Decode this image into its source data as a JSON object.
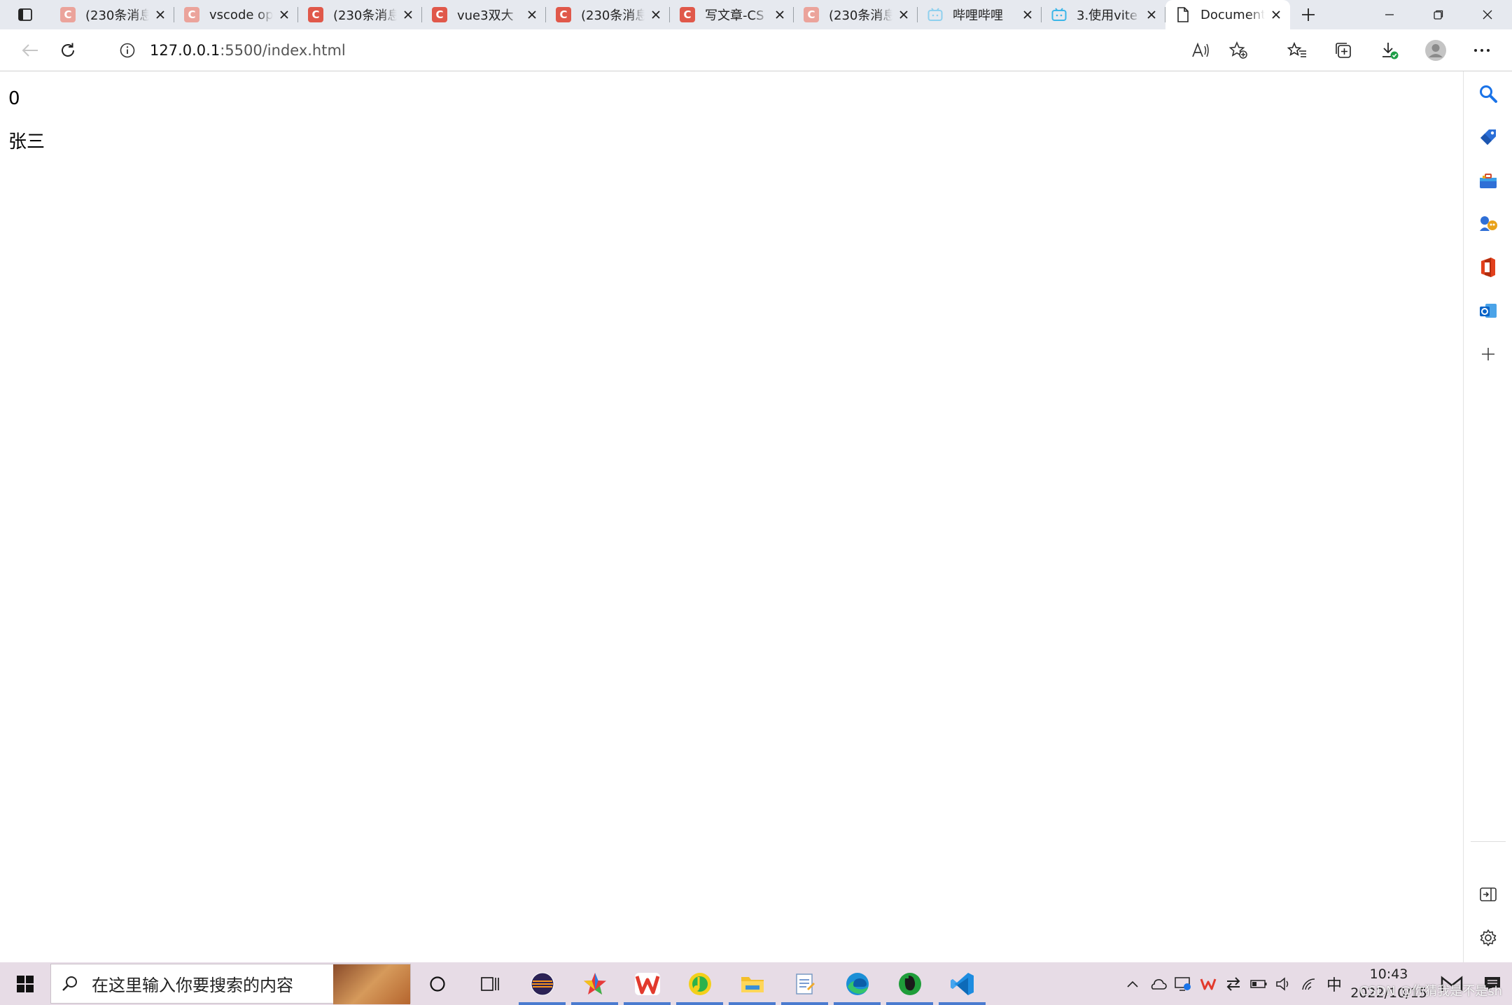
{
  "browser": {
    "tabs": [
      {
        "title": "(230条消息",
        "favicon": "csdn-dim"
      },
      {
        "title": "vscode op",
        "favicon": "csdn-dim"
      },
      {
        "title": "(230条消息",
        "favicon": "csdn"
      },
      {
        "title": "vue3双大",
        "favicon": "csdn"
      },
      {
        "title": "(230条消息",
        "favicon": "csdn"
      },
      {
        "title": "写文章-CS",
        "favicon": "csdn"
      },
      {
        "title": "(230条消息",
        "favicon": "csdn-dim"
      },
      {
        "title": "哔哩哔哩",
        "favicon": "bilibili-dim"
      },
      {
        "title": "3.使用vite",
        "favicon": "bilibili"
      },
      {
        "title": "Document",
        "favicon": "page",
        "active": true
      }
    ],
    "address": {
      "host": "127.0.0.1",
      "rest": ":5500/index.html"
    }
  },
  "page": {
    "count": "0",
    "name": "张三"
  },
  "taskbar": {
    "search_placeholder": "在这里输入你要搜索的内容",
    "ime": "中",
    "time": "10:43",
    "date": "2022/10/15",
    "watermark": "CSDN @你猜我是不是sh"
  },
  "colors": {
    "csdn": "#e0584a",
    "bilibili": "#3bb6e8",
    "accent": "#1a73e8",
    "taskbar": "#e7dce6"
  }
}
